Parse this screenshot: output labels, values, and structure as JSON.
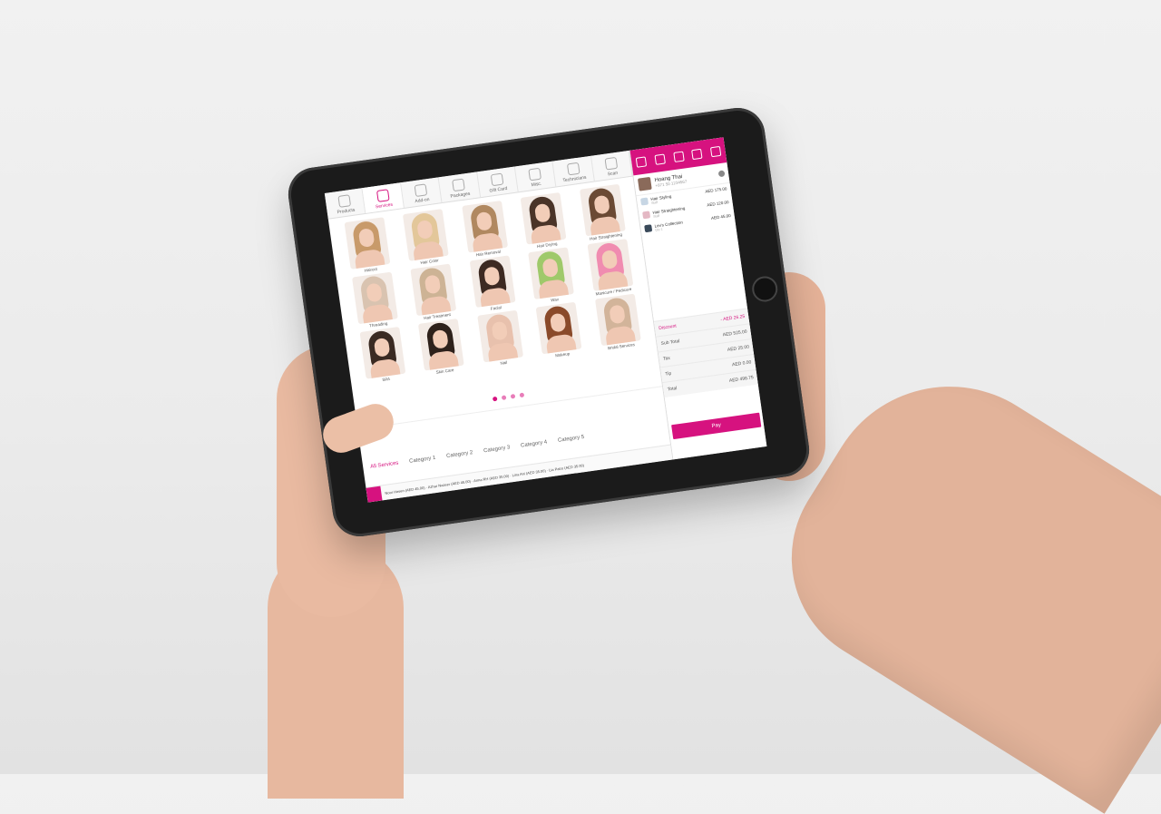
{
  "tabs": [
    {
      "label": "Products"
    },
    {
      "label": "Services",
      "active": true
    },
    {
      "label": "Add-on"
    },
    {
      "label": "Packages"
    },
    {
      "label": "Gift Card"
    },
    {
      "label": "Misc."
    },
    {
      "label": "Technicians"
    },
    {
      "label": "Scan"
    }
  ],
  "services": [
    {
      "label": "Haircut"
    },
    {
      "label": "Hair Color"
    },
    {
      "label": "Hair Removal"
    },
    {
      "label": "Hair Drying"
    },
    {
      "label": "Hair Straightening"
    },
    {
      "label": "Threading"
    },
    {
      "label": "Hair Treatment"
    },
    {
      "label": "Facial"
    },
    {
      "label": "Wax"
    },
    {
      "label": "Manicure / Pedicure"
    },
    {
      "label": "SPA"
    },
    {
      "label": "Skin Care"
    },
    {
      "label": "Nail"
    },
    {
      "label": "Makeup"
    },
    {
      "label": "Bridal Services"
    }
  ],
  "pagination": {
    "pages": 4,
    "current": 0
  },
  "categories": [
    {
      "label": "All Services",
      "active": true
    },
    {
      "label": "Category 1"
    },
    {
      "label": "Category 2"
    },
    {
      "label": "Category 3"
    },
    {
      "label": "Category 4"
    },
    {
      "label": "Category 5"
    }
  ],
  "ticker": "Noor Haven (AED 45.00) · Azhar Nazeer (AED 45.00) · Anna RH (AED 35.00) · Lina Ani (AED 35.00) · Lia Patro (AED 35.00)",
  "customer": {
    "name": "Hoang Thai",
    "phone": "+971 50 1234567"
  },
  "cart": [
    {
      "name": "Hair Styling",
      "sub": "Staff",
      "price": "AED 175.00"
    },
    {
      "name": "Hair Straightening",
      "sub": "Staff",
      "price": "AED 120.00"
    },
    {
      "name": "Lev's Collection",
      "sub": "Qty 1",
      "price": "AED 45.00"
    }
  ],
  "totals": {
    "discount_label": "Discount",
    "discount": "- AED 26.25",
    "subtotal_label": "Sub Total",
    "subtotal": "AED 525.00",
    "tax_label": "Tax",
    "tax": "AED 25.00",
    "tip_label": "Tip",
    "tip": "AED 0.00",
    "total_label": "Total",
    "total": "AED 498.75"
  },
  "pay_label": "Pay",
  "accent": "#d6127f"
}
